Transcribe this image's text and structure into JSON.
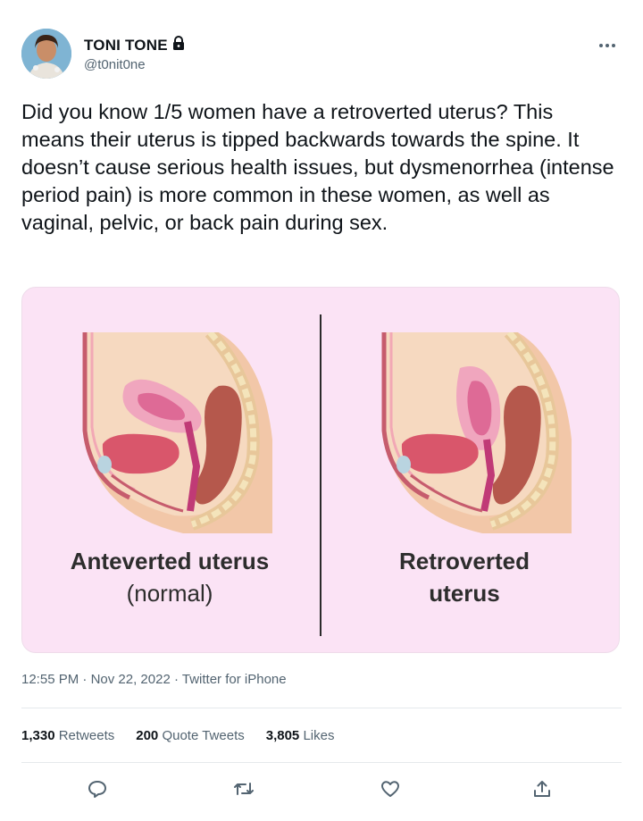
{
  "author": {
    "name": "TONI TONE",
    "handle": "@t0nit0ne",
    "verified_icon": "lock-icon"
  },
  "more_icon": "ellipsis-icon",
  "tweet_text": "Did you know 1/5 women have a retroverted uterus? This means their uterus is tipped backwards towards the spine. It doesn’t cause serious health issues, but dysmenorrhea (intense period pain) is more common in these women, as well as vaginal, pelvic, or back pain during sex.",
  "image": {
    "left_caption_line1": "Anteverted uterus",
    "left_caption_line2": "(normal)",
    "right_caption_line1": "Retroverted",
    "right_caption_line2": "uterus",
    "background": "#fbe3f5"
  },
  "meta": {
    "time": "12:55 PM",
    "date": "Nov 22, 2022",
    "source": "Twitter for iPhone",
    "separator": "·"
  },
  "stats": {
    "retweets_count": "1,330",
    "retweets_label": "Retweets",
    "quotes_count": "200",
    "quotes_label": "Quote Tweets",
    "likes_count": "3,805",
    "likes_label": "Likes"
  },
  "actions": [
    "reply-icon",
    "retweet-icon",
    "like-icon",
    "share-icon"
  ]
}
